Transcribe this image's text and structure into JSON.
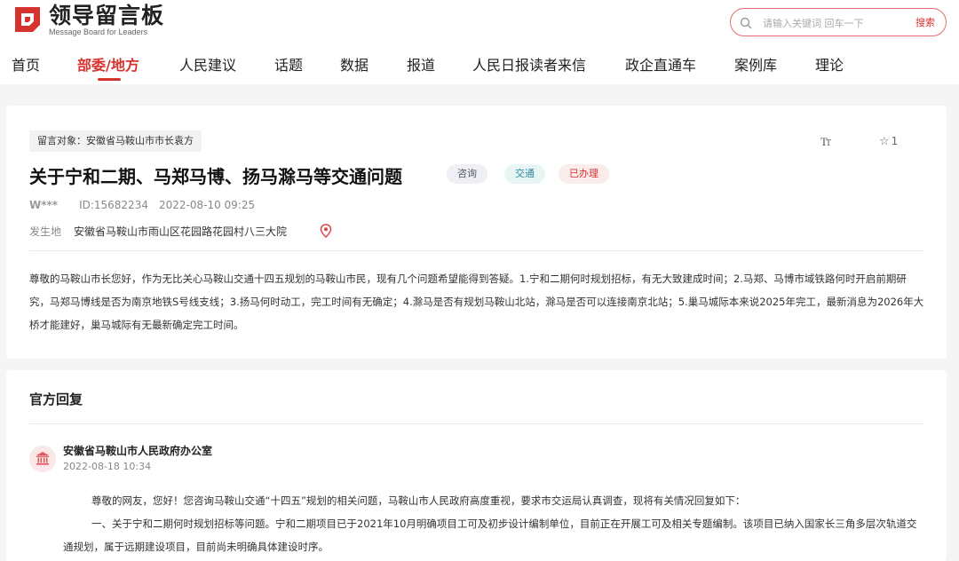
{
  "site": {
    "name_cn": "领导留言板",
    "name_en": "Message Board for Leaders",
    "brand_color": "#d6322e"
  },
  "search": {
    "placeholder": "请输入关键词 回车一下",
    "button_label": "搜索"
  },
  "nav": {
    "items": [
      "首页",
      "部委/地方",
      "人民建议",
      "话题",
      "数据",
      "报道",
      "人民日报读者来信",
      "政企直通车",
      "案例库",
      "理论"
    ],
    "active_index": 1
  },
  "message": {
    "target_label": "留言对象：安徽省马鞍山市市长袁方",
    "font_size_icon": "font-size-icon",
    "favorite_count": "1",
    "title": "关于宁和二期、马郑马博、扬马滁马等交通问题",
    "badges": [
      "咨询",
      "交通",
      "已办理"
    ],
    "user": "W***",
    "id": "ID:15682234",
    "datetime": "2022-08-10 09:25",
    "location_label": "发生地",
    "location": "安徽省马鞍山市雨山区花园路花园村八三大院",
    "content": "尊敬的马鞍山市长您好，作为无比关心马鞍山交通十四五规划的马鞍山市民，现有几个问题希望能得到答疑。1.宁和二期何时规划招标，有无大致建成时间；2.马郑、马博市域铁路何时开启前期研究，马郑马博线是否为南京地铁S号线支线；3.扬马何时动工，完工时间有无确定；4.滁马是否有规划马鞍山北站，滁马是否可以连接南京北站；5.巢马城际本来说2025年完工，最新消息为2026年大桥才能建好，巢马城际有无最新确定完工时间。"
  },
  "reply": {
    "heading": "官方回复",
    "org": "安徽省马鞍山市人民政府办公室",
    "datetime": "2022-08-18 10:34",
    "para1": "尊敬的网友，您好！您咨询马鞍山交通“十四五”规划的相关问题，马鞍山市人民政府高度重视，要求市交运局认真调查，现将有关情况回复如下：",
    "para2": "一、关于宁和二期何时规划招标等问题。宁和二期项目已于2021年10月明确项目工可及初步设计编制单位，目前正在开展工可及相关专题编制。该项目已纳入国家长三角多层次轨道交通规划，属于远期建设项目，目前尚未明确具体建设时序。"
  }
}
